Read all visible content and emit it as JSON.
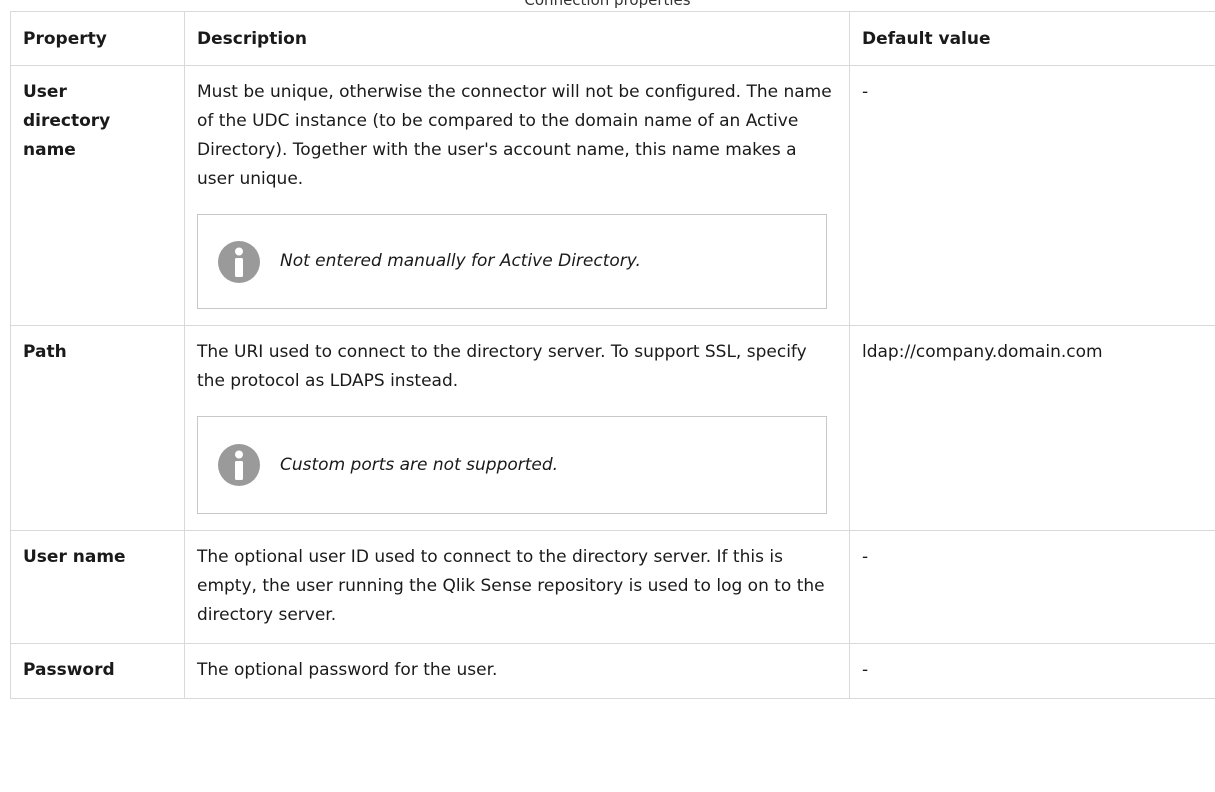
{
  "caption": "Connection properties",
  "table": {
    "headers": {
      "property": "Property",
      "description": "Description",
      "default_value": "Default value"
    },
    "rows": [
      {
        "property": "User directory name",
        "description": "Must be unique, otherwise the connector will not be configured. The name of the UDC instance (to be compared to the domain name of an Active Directory). Together with the user's account name, this name makes a user unique.",
        "note": "Not entered manually for Active Directory.",
        "default_value": "-"
      },
      {
        "property": "Path",
        "description": "The URI used to connect to the directory server. To support SSL, specify the protocol as LDAPS instead.",
        "note": "Custom ports are not supported.",
        "default_value": "ldap://company.domain.com"
      },
      {
        "property": "User name",
        "description": "The optional user ID used to connect to the directory server. If this is empty, the user running the Qlik Sense repository is used to log on to the directory server.",
        "default_value": "-"
      },
      {
        "property": "Password",
        "description": "The optional password for the user.",
        "default_value": "-"
      }
    ]
  },
  "icons": {
    "note": "info-icon"
  },
  "colors": {
    "border": "#d9d9d9",
    "note_border": "#c8c8c8",
    "info_icon": "#9a9a9a"
  }
}
